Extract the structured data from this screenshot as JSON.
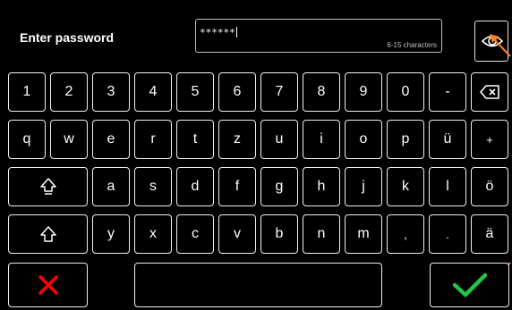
{
  "title": "Enter password",
  "password": {
    "masked_value": "******",
    "hint": "6-15 characters"
  },
  "icons": {
    "show_password": "eye-icon",
    "backspace": "backspace-icon",
    "caps_lock": "caps-lock-icon",
    "shift": "shift-icon",
    "cancel": "cancel-x-icon",
    "confirm": "check-icon"
  },
  "keys": {
    "row1": [
      "1",
      "2",
      "3",
      "4",
      "5",
      "6",
      "7",
      "8",
      "9",
      "0",
      "-"
    ],
    "row2": [
      "q",
      "w",
      "e",
      "r",
      "t",
      "z",
      "u",
      "i",
      "o",
      "p",
      "ü",
      "+"
    ],
    "row3": [
      "a",
      "s",
      "d",
      "f",
      "g",
      "h",
      "j",
      "k",
      "l",
      "ö"
    ],
    "row4": [
      "y",
      "x",
      "c",
      "v",
      "b",
      "n",
      "m",
      ",",
      ".",
      "ä"
    ]
  },
  "colors": {
    "cancel": "#ff0000",
    "confirm": "#23c44a",
    "annotation_arrow": "#ff7f1a"
  }
}
